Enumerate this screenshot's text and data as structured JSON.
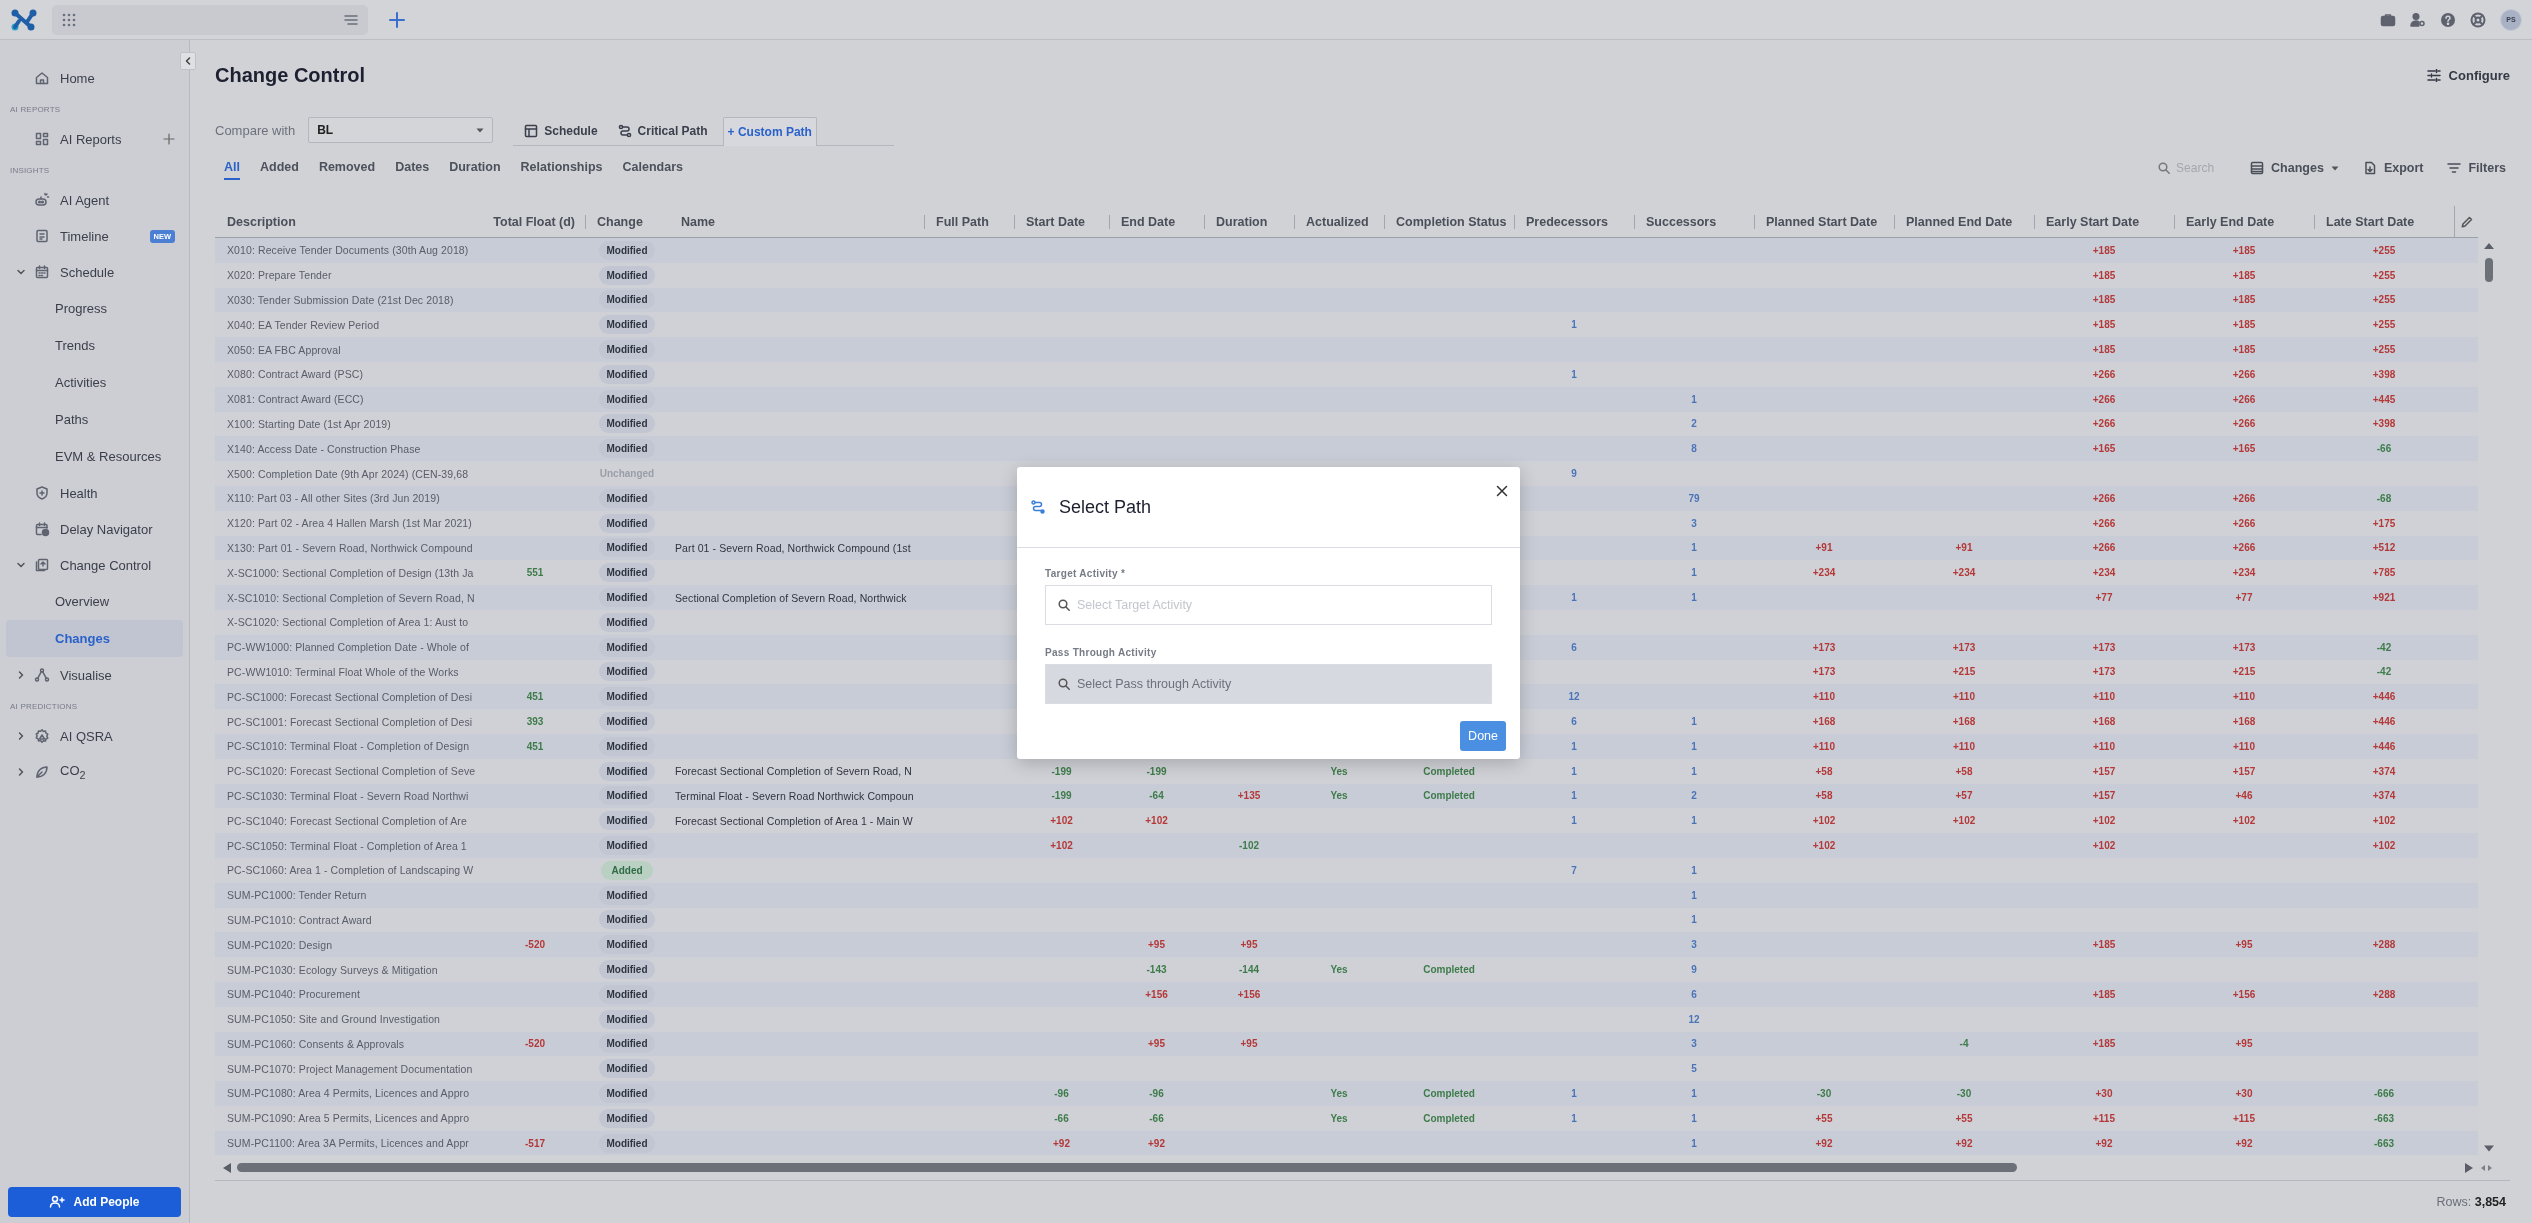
{
  "top_bar": {
    "avatar": "PS"
  },
  "sidebar": {
    "sections": [
      {
        "items": [
          {
            "label": "Home",
            "selected": false
          }
        ]
      },
      {
        "heading": "AI REPORTS",
        "items": [
          {
            "label": "AI Reports",
            "selected": false
          }
        ]
      },
      {
        "heading": "INSIGHTS",
        "items": [
          {
            "label": "AI Agent",
            "selected": false
          },
          {
            "label": "Timeline",
            "badge": "NEW",
            "selected": false
          },
          {
            "label": "Schedule",
            "selected": false,
            "expanded": true,
            "children": [
              {
                "label": "Progress",
                "selected": false
              },
              {
                "label": "Trends",
                "selected": false
              },
              {
                "label": "Activities",
                "selected": false
              },
              {
                "label": "Paths",
                "selected": false
              },
              {
                "label": "EVM & Resources",
                "selected": false
              }
            ]
          },
          {
            "label": "Health",
            "selected": false
          },
          {
            "label": "Delay Navigator",
            "selected": false
          },
          {
            "label": "Change Control",
            "selected": false,
            "expanded": true,
            "children": [
              {
                "label": "Overview",
                "selected": false
              },
              {
                "label": "Changes",
                "selected": true
              }
            ]
          },
          {
            "label": "Visualise",
            "selected": false,
            "expanded": false
          }
        ]
      },
      {
        "heading": "AI PREDICTIONS",
        "items": [
          {
            "label": "AI QSRA",
            "selected": false,
            "expanded": false
          },
          {
            "label": "CO$_{2}$",
            "selected": false,
            "expanded": false
          }
        ]
      }
    ],
    "add_button": "Add People"
  },
  "page": {
    "title": "Change Control",
    "configure": "Configure"
  },
  "compare": {
    "label": "Compare with",
    "value": "BL"
  },
  "view_tabs": [
    {
      "label": "Schedule",
      "selected": false
    },
    {
      "label": "Critical Path",
      "selected": false
    },
    {
      "label": "+ Custom Path",
      "selected": true
    }
  ],
  "filter_tabs": [
    {
      "label": "All",
      "selected": true
    },
    {
      "label": "Added",
      "selected": false
    },
    {
      "label": "Removed",
      "selected": false
    },
    {
      "label": "Dates",
      "selected": false
    },
    {
      "label": "Duration",
      "selected": false
    },
    {
      "label": "Relationships",
      "selected": false
    },
    {
      "label": "Calendars",
      "selected": false
    }
  ],
  "toolbar": {
    "search": {
      "placeholder": "Search"
    },
    "buttons": [
      {
        "label": "Changes",
        "kind": "dropdown"
      },
      {
        "label": "Export",
        "kind": "button"
      },
      {
        "label": "Filters",
        "kind": "button"
      }
    ]
  },
  "table": {
    "columns": [
      "Description",
      "Total Float (d)",
      "Change",
      "Name",
      "Full Path",
      "Start Date",
      "End Date",
      "Duration",
      "Actualized",
      "Completion Status",
      "Predecessors",
      "Successors",
      "Planned Start Date",
      "Planned End Date",
      "Early Start Date",
      "Early End Date",
      "Late Start Date"
    ],
    "rows": [
      {
        "description": "X010: Receive Tender Documents (30th Aug 2018)",
        "change": {
          "label": "Modified",
          "kind": "modified"
        },
        "early_start_date": {
          "text": "+185",
          "adverse": true
        },
        "early_end_date": {
          "text": "+185",
          "adverse": true
        },
        "late_start_date": {
          "text": "+255",
          "adverse": true
        }
      },
      {
        "description": "X020: Prepare Tender",
        "change": {
          "label": "Modified",
          "kind": "modified"
        },
        "early_start_date": {
          "text": "+185",
          "adverse": true
        },
        "early_end_date": {
          "text": "+185",
          "adverse": true
        },
        "late_start_date": {
          "text": "+255",
          "adverse": true
        }
      },
      {
        "description": "X030: Tender Submission Date (21st Dec 2018)",
        "change": {
          "label": "Modified",
          "kind": "modified"
        },
        "early_start_date": {
          "text": "+185",
          "adverse": true
        },
        "early_end_date": {
          "text": "+185",
          "adverse": true
        },
        "late_start_date": {
          "text": "+255",
          "adverse": true
        }
      },
      {
        "description": "X040: EA Tender Review Period",
        "change": {
          "label": "Modified",
          "kind": "modified"
        },
        "predecessors": "1",
        "early_start_date": {
          "text": "+185",
          "adverse": true
        },
        "early_end_date": {
          "text": "+185",
          "adverse": true
        },
        "late_start_date": {
          "text": "+255",
          "adverse": true
        }
      },
      {
        "description": "X050: EA FBC Approval",
        "change": {
          "label": "Modified",
          "kind": "modified"
        },
        "early_start_date": {
          "text": "+185",
          "adverse": true
        },
        "early_end_date": {
          "text": "+185",
          "adverse": true
        },
        "late_start_date": {
          "text": "+255",
          "adverse": true
        }
      },
      {
        "description": "X080: Contract Award (PSC)",
        "change": {
          "label": "Modified",
          "kind": "modified"
        },
        "predecessors": "1",
        "early_start_date": {
          "text": "+266",
          "adverse": true
        },
        "early_end_date": {
          "text": "+266",
          "adverse": true
        },
        "late_start_date": {
          "text": "+398",
          "adverse": true
        }
      },
      {
        "description": "X081: Contract Award (ECC)",
        "change": {
          "label": "Modified",
          "kind": "modified"
        },
        "successors": "1",
        "early_start_date": {
          "text": "+266",
          "adverse": true
        },
        "early_end_date": {
          "text": "+266",
          "adverse": true
        },
        "late_start_date": {
          "text": "+445",
          "adverse": true
        }
      },
      {
        "description": "X100: Starting Date (1st Apr 2019)",
        "change": {
          "label": "Modified",
          "kind": "modified"
        },
        "successors": "2",
        "early_start_date": {
          "text": "+266",
          "adverse": true
        },
        "early_end_date": {
          "text": "+266",
          "adverse": true
        },
        "late_start_date": {
          "text": "+398",
          "adverse": true
        }
      },
      {
        "description": "X140: Access Date - Construction Phase",
        "change": {
          "label": "Modified",
          "kind": "modified"
        },
        "successors": "8",
        "early_start_date": {
          "text": "+165",
          "adverse": true
        },
        "early_end_date": {
          "text": "+165",
          "adverse": true
        },
        "late_start_date": {
          "text": "-66",
          "adverse": false
        }
      },
      {
        "description": "X500: Completion Date (9th Apr 2024) (CEN-39,68",
        "change": {
          "label": "Unchanged",
          "kind": "unchanged"
        },
        "predecessors": "9"
      },
      {
        "description": "X110: Part 03 - All other Sites (3rd Jun 2019)",
        "change": {
          "label": "Modified",
          "kind": "modified"
        },
        "successors": "79",
        "early_start_date": {
          "text": "+266",
          "adverse": true
        },
        "early_end_date": {
          "text": "+266",
          "adverse": true
        },
        "late_start_date": {
          "text": "-68",
          "adverse": false
        }
      },
      {
        "description": "X120: Part 02 - Area 4 Hallen Marsh (1st Mar 2021)",
        "change": {
          "label": "Modified",
          "kind": "modified"
        },
        "successors": "3",
        "early_start_date": {
          "text": "+266",
          "adverse": true
        },
        "early_end_date": {
          "text": "+266",
          "adverse": true
        },
        "late_start_date": {
          "text": "+175",
          "adverse": true
        }
      },
      {
        "description": "X130: Part 01 - Severn Road, Northwick Compound",
        "change": {
          "label": "Modified",
          "kind": "modified"
        },
        "name": "Part 01 - Severn Road, Northwick Compound (1st",
        "successors": "1",
        "planned_start_date": {
          "text": "+91",
          "adverse": true
        },
        "planned_end_date": {
          "text": "+91",
          "adverse": true
        },
        "early_start_date": {
          "text": "+266",
          "adverse": true
        },
        "early_end_date": {
          "text": "+266",
          "adverse": true
        },
        "late_start_date": {
          "text": "+512",
          "adverse": true
        }
      },
      {
        "description": "X-SC1000: Sectional Completion of Design (13th Ja",
        "total_float": {
          "text": "551",
          "adverse": false
        },
        "change": {
          "label": "Modified",
          "kind": "modified"
        },
        "successors": "1",
        "planned_start_date": {
          "text": "+234",
          "adverse": true
        },
        "planned_end_date": {
          "text": "+234",
          "adverse": true
        },
        "early_start_date": {
          "text": "+234",
          "adverse": true
        },
        "early_end_date": {
          "text": "+234",
          "adverse": true
        },
        "late_start_date": {
          "text": "+785",
          "adverse": true
        }
      },
      {
        "description": "X-SC1010: Sectional Completion of Severn Road, N",
        "change": {
          "label": "Modified",
          "kind": "modified"
        },
        "name": "Sectional Completion of Severn Road, Northwick",
        "predecessors": "1",
        "successors": "1",
        "early_start_date": {
          "text": "+77",
          "adverse": true
        },
        "early_end_date": {
          "text": "+77",
          "adverse": true
        },
        "late_start_date": {
          "text": "+921",
          "adverse": true
        }
      },
      {
        "description": "X-SC1020: Sectional Completion of Area 1: Aust to",
        "change": {
          "label": "Modified",
          "kind": "modified"
        }
      },
      {
        "description": "PC-WW1000: Planned Completion Date - Whole of",
        "change": {
          "label": "Modified",
          "kind": "modified"
        },
        "predecessors": "6",
        "planned_start_date": {
          "text": "+173",
          "adverse": true
        },
        "planned_end_date": {
          "text": "+173",
          "adverse": true
        },
        "early_start_date": {
          "text": "+173",
          "adverse": true
        },
        "early_end_date": {
          "text": "+173",
          "adverse": true
        },
        "late_start_date": {
          "text": "-42",
          "adverse": false
        }
      },
      {
        "description": "PC-WW1010: Terminal Float Whole of the Works",
        "change": {
          "label": "Modified",
          "kind": "modified"
        },
        "planned_start_date": {
          "text": "+173",
          "adverse": true
        },
        "planned_end_date": {
          "text": "+215",
          "adverse": true
        },
        "early_start_date": {
          "text": "+173",
          "adverse": true
        },
        "early_end_date": {
          "text": "+215",
          "adverse": true
        },
        "late_start_date": {
          "text": "-42",
          "adverse": false
        }
      },
      {
        "description": "PC-SC1000: Forecast Sectional Completion of Desi",
        "total_float": {
          "text": "451",
          "adverse": false
        },
        "change": {
          "label": "Modified",
          "kind": "modified"
        },
        "predecessors": "12",
        "planned_start_date": {
          "text": "+110",
          "adverse": true
        },
        "planned_end_date": {
          "text": "+110",
          "adverse": true
        },
        "early_start_date": {
          "text": "+110",
          "adverse": true
        },
        "early_end_date": {
          "text": "+110",
          "adverse": true
        },
        "late_start_date": {
          "text": "+446",
          "adverse": true
        }
      },
      {
        "description": "PC-SC1001: Forecast Sectional Completion of Desi",
        "total_float": {
          "text": "393",
          "adverse": false
        },
        "change": {
          "label": "Modified",
          "kind": "modified"
        },
        "predecessors": "6",
        "successors": "1",
        "planned_start_date": {
          "text": "+168",
          "adverse": true
        },
        "planned_end_date": {
          "text": "+168",
          "adverse": true
        },
        "early_start_date": {
          "text": "+168",
          "adverse": true
        },
        "early_end_date": {
          "text": "+168",
          "adverse": true
        },
        "late_start_date": {
          "text": "+446",
          "adverse": true
        }
      },
      {
        "description": "PC-SC1010: Terminal Float - Completion of Design",
        "total_float": {
          "text": "451",
          "adverse": false
        },
        "change": {
          "label": "Modified",
          "kind": "modified"
        },
        "predecessors": "1",
        "successors": "1",
        "planned_start_date": {
          "text": "+110",
          "adverse": true
        },
        "planned_end_date": {
          "text": "+110",
          "adverse": true
        },
        "early_start_date": {
          "text": "+110",
          "adverse": true
        },
        "early_end_date": {
          "text": "+110",
          "adverse": true
        },
        "late_start_date": {
          "text": "+446",
          "adverse": true
        }
      },
      {
        "description": "PC-SC1020: Forecast Sectional Completion of Seve",
        "change": {
          "label": "Modified",
          "kind": "modified"
        },
        "name": "Forecast Sectional Completion of Severn Road, N",
        "start_date": {
          "text": "-199",
          "adverse": false
        },
        "end_date": {
          "text": "-199",
          "adverse": false
        },
        "actualized": "Yes",
        "completion_status": "Completed",
        "predecessors": "1",
        "successors": "1",
        "planned_start_date": {
          "text": "+58",
          "adverse": true
        },
        "planned_end_date": {
          "text": "+58",
          "adverse": true
        },
        "early_start_date": {
          "text": "+157",
          "adverse": true
        },
        "early_end_date": {
          "text": "+157",
          "adverse": true
        },
        "late_start_date": {
          "text": "+374",
          "adverse": true
        }
      },
      {
        "description": "PC-SC1030: Terminal Float - Severn Road Northwi",
        "change": {
          "label": "Modified",
          "kind": "modified"
        },
        "name": "Terminal Float - Severn Road Northwick Compoun",
        "start_date": {
          "text": "-199",
          "adverse": false
        },
        "end_date": {
          "text": "-64",
          "adverse": false
        },
        "duration": {
          "text": "+135",
          "adverse": true
        },
        "actualized": "Yes",
        "completion_status": "Completed",
        "predecessors": "1",
        "successors": "2",
        "planned_start_date": {
          "text": "+58",
          "adverse": true
        },
        "planned_end_date": {
          "text": "+57",
          "adverse": true
        },
        "early_start_date": {
          "text": "+157",
          "adverse": true
        },
        "early_end_date": {
          "text": "+46",
          "adverse": true
        },
        "late_start_date": {
          "text": "+374",
          "adverse": true
        }
      },
      {
        "description": "PC-SC1040: Forecast Sectional Completion of Are",
        "change": {
          "label": "Modified",
          "kind": "modified"
        },
        "name": "Forecast Sectional Completion of Area 1 - Main W",
        "start_date": {
          "text": "+102",
          "adverse": true
        },
        "end_date": {
          "text": "+102",
          "adverse": true
        },
        "predecessors": "1",
        "successors": "1",
        "planned_start_date": {
          "text": "+102",
          "adverse": true
        },
        "planned_end_date": {
          "text": "+102",
          "adverse": true
        },
        "early_start_date": {
          "text": "+102",
          "adverse": true
        },
        "early_end_date": {
          "text": "+102",
          "adverse": true
        },
        "late_start_date": {
          "text": "+102",
          "adverse": true
        }
      },
      {
        "description": "PC-SC1050: Terminal Float - Completion of Area 1",
        "change": {
          "label": "Modified",
          "kind": "modified"
        },
        "start_date": {
          "text": "+102",
          "adverse": true
        },
        "duration": {
          "text": "-102",
          "adverse": false
        },
        "planned_start_date": {
          "text": "+102",
          "adverse": true
        },
        "early_start_date": {
          "text": "+102",
          "adverse": true
        },
        "late_start_date": {
          "text": "+102",
          "adverse": true
        }
      },
      {
        "description": "PC-SC1060: Area 1 - Completion of Landscaping W",
        "change": {
          "label": "Added",
          "kind": "added"
        },
        "predecessors": "7",
        "successors": "1"
      },
      {
        "description": "SUM-PC1000: Tender Return",
        "change": {
          "label": "Modified",
          "kind": "modified"
        },
        "successors": "1"
      },
      {
        "description": "SUM-PC1010: Contract Award",
        "change": {
          "label": "Modified",
          "kind": "modified"
        },
        "successors": "1"
      },
      {
        "description": "SUM-PC1020: Design",
        "total_float": {
          "text": "-520",
          "adverse": true
        },
        "change": {
          "label": "Modified",
          "kind": "modified"
        },
        "end_date": {
          "text": "+95",
          "adverse": true
        },
        "duration": {
          "text": "+95",
          "adverse": true
        },
        "successors": "3",
        "early_start_date": {
          "text": "+185",
          "adverse": true
        },
        "early_end_date": {
          "text": "+95",
          "adverse": true
        },
        "late_start_date": {
          "text": "+288",
          "adverse": true
        }
      },
      {
        "description": "SUM-PC1030: Ecology Surveys & Mitigation",
        "change": {
          "label": "Modified",
          "kind": "modified"
        },
        "end_date": {
          "text": "-143",
          "adverse": false
        },
        "duration": {
          "text": "-144",
          "adverse": false
        },
        "actualized": "Yes",
        "completion_status": "Completed",
        "successors": "9"
      },
      {
        "description": "SUM-PC1040: Procurement",
        "change": {
          "label": "Modified",
          "kind": "modified"
        },
        "end_date": {
          "text": "+156",
          "adverse": true
        },
        "duration": {
          "text": "+156",
          "adverse": true
        },
        "successors": "6",
        "early_start_date": {
          "text": "+185",
          "adverse": true
        },
        "early_end_date": {
          "text": "+156",
          "adverse": true
        },
        "late_start_date": {
          "text": "+288",
          "adverse": true
        }
      },
      {
        "description": "SUM-PC1050: Site and Ground Investigation",
        "change": {
          "label": "Modified",
          "kind": "modified"
        },
        "successors": "12"
      },
      {
        "description": "SUM-PC1060: Consents & Approvals",
        "total_float": {
          "text": "-520",
          "adverse": true
        },
        "change": {
          "label": "Modified",
          "kind": "modified"
        },
        "end_date": {
          "text": "+95",
          "adverse": true
        },
        "duration": {
          "text": "+95",
          "adverse": true
        },
        "successors": "3",
        "planned_end_date": {
          "text": "-4",
          "adverse": false
        },
        "early_start_date": {
          "text": "+185",
          "adverse": true
        },
        "early_end_date": {
          "text": "+95",
          "adverse": true
        }
      },
      {
        "description": "SUM-PC1070: Project Management Documentation",
        "change": {
          "label": "Modified",
          "kind": "modified"
        },
        "successors": "5"
      },
      {
        "description": "SUM-PC1080: Area 4 Permits, Licences and Appro",
        "change": {
          "label": "Modified",
          "kind": "modified"
        },
        "start_date": {
          "text": "-96",
          "adverse": false
        },
        "end_date": {
          "text": "-96",
          "adverse": false
        },
        "actualized": "Yes",
        "completion_status": "Completed",
        "predecessors": "1",
        "successors": "1",
        "planned_start_date": {
          "text": "-30",
          "adverse": false
        },
        "planned_end_date": {
          "text": "-30",
          "adverse": false
        },
        "early_start_date": {
          "text": "+30",
          "adverse": true
        },
        "early_end_date": {
          "text": "+30",
          "adverse": true
        },
        "late_start_date": {
          "text": "-666",
          "adverse": false
        }
      },
      {
        "description": "SUM-PC1090: Area 5 Permits, Licences and Appro",
        "change": {
          "label": "Modified",
          "kind": "modified"
        },
        "start_date": {
          "text": "-66",
          "adverse": false
        },
        "end_date": {
          "text": "-66",
          "adverse": false
        },
        "actualized": "Yes",
        "completion_status": "Completed",
        "predecessors": "1",
        "successors": "1",
        "planned_start_date": {
          "text": "+55",
          "adverse": true
        },
        "planned_end_date": {
          "text": "+55",
          "adverse": true
        },
        "early_start_date": {
          "text": "+115",
          "adverse": true
        },
        "early_end_date": {
          "text": "+115",
          "adverse": true
        },
        "late_start_date": {
          "text": "-663",
          "adverse": false
        }
      },
      {
        "description": "SUM-PC1100: Area 3A Permits, Licences and Appr",
        "total_float": {
          "text": "-517",
          "adverse": true
        },
        "change": {
          "label": "Modified",
          "kind": "modified"
        },
        "start_date": {
          "text": "+92",
          "adverse": true
        },
        "end_date": {
          "text": "+92",
          "adverse": true
        },
        "successors": "1",
        "planned_start_date": {
          "text": "+92",
          "adverse": true
        },
        "planned_end_date": {
          "text": "+92",
          "adverse": true
        },
        "early_start_date": {
          "text": "+92",
          "adverse": true
        },
        "early_end_date": {
          "text": "+92",
          "adverse": true
        },
        "late_start_date": {
          "text": "-663",
          "adverse": false
        }
      }
    ]
  },
  "status_bar": {
    "row_count": "Rows: **3,854**"
  },
  "modal": {
    "title": "Select Path",
    "fields": [
      {
        "label": "Target Activity *",
        "placeholder": "Select Target Activity",
        "disabled": false
      },
      {
        "label": "Pass Through Activity",
        "placeholder": "Select Pass through Activity",
        "disabled": true
      }
    ],
    "button": "Done"
  }
}
